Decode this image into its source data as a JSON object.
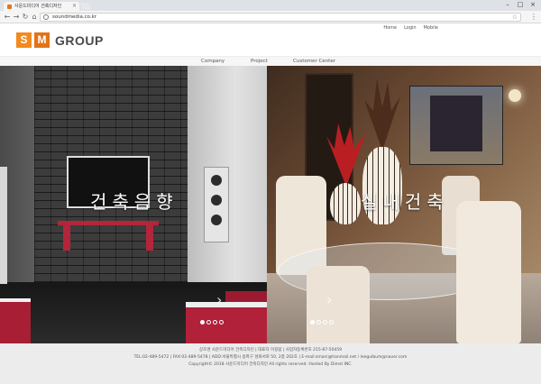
{
  "browser": {
    "tab_title": "사운드미디어 건축디자인",
    "tab_close": "×",
    "url": "soundmedia.co.kr",
    "window_controls": [
      "–",
      "□",
      "×"
    ],
    "nav": {
      "back": "←",
      "forward": "→",
      "reload": "↻",
      "home": "⌂"
    },
    "star": "☆",
    "menu": "⋮"
  },
  "header": {
    "logo": {
      "s": "S",
      "m": "M",
      "group": "GROUP"
    },
    "util_nav": [
      "Home",
      "Login",
      "Mobile"
    ]
  },
  "gnb": [
    "Company",
    "Project",
    "Customer Center"
  ],
  "hero": {
    "left": {
      "title": "건축음향",
      "arrow": "›",
      "accent": "#b3253a"
    },
    "right": {
      "title": "실내건축",
      "arrow": "›",
      "accent": "#b91f22"
    },
    "dots_active_index": 0,
    "dot_count": 4
  },
  "footer": {
    "line1": "상호명 사운드미디어 건축디자인 | 대표자 이길림 | 사업자등록번호 215-87-50459",
    "line2": "TEL:02-489-5472 | FAX:02-489-5478 | ADD:서울특별시 송파구 성화서로 50, 2층 202호 | E-mail:smarc@hanmail.net / leegulbum@naver.com",
    "line3": "Copyright© 2018 사운드미디어 건축디자인 All rights reserved. Hosted By Dimst INC."
  },
  "colors": {
    "logo_s": "#f28a1f",
    "logo_m": "#e07418",
    "footer_bg": "#ececec"
  }
}
